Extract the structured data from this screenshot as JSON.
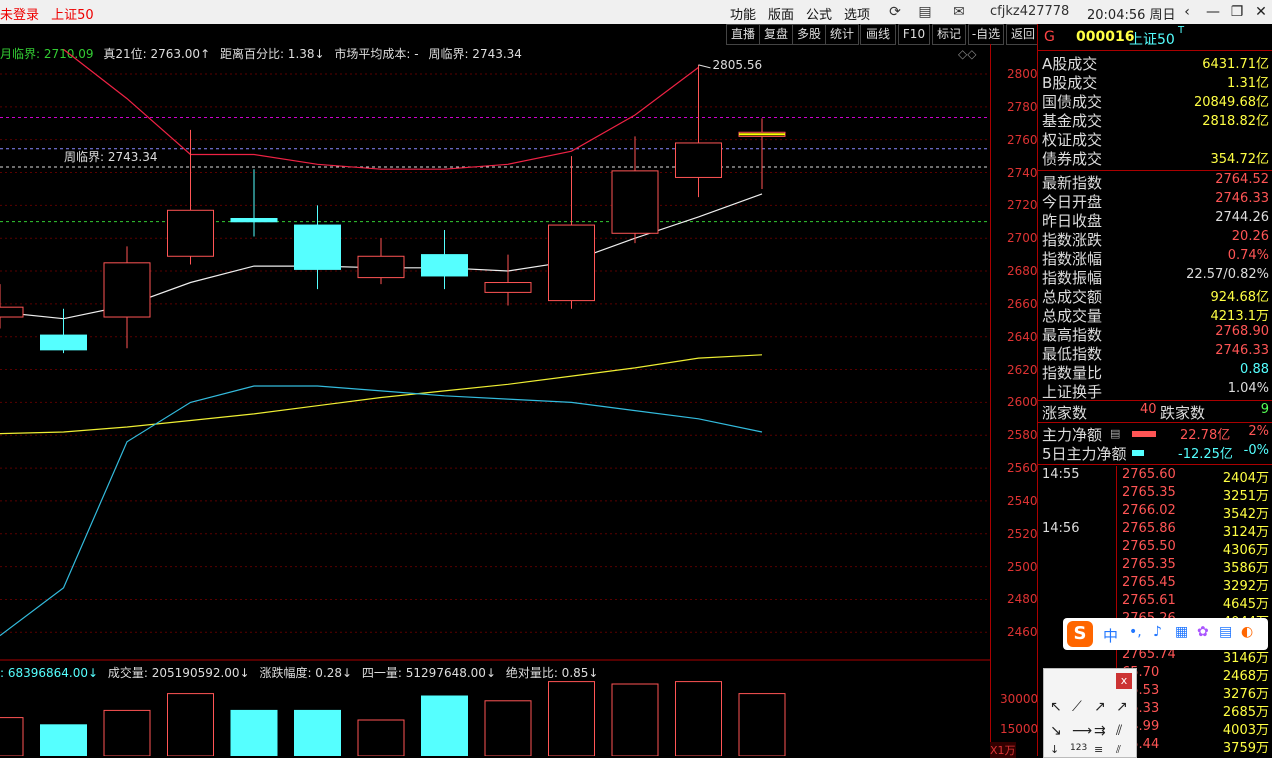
{
  "topbar": {
    "status": "未登录",
    "index_name": "上证50",
    "menus": [
      "功能",
      "版面",
      "公式",
      "选项"
    ],
    "user": "cfjkz427778",
    "time": "20:04:56 周日"
  },
  "toolbar": {
    "buttons": [
      "直播",
      "复盘",
      "多股",
      "统计",
      "画线",
      "F10",
      "标记",
      "-自选",
      "返回"
    ]
  },
  "infoline": {
    "items": [
      "月临界: 2710.09",
      "真21位: 2763.00↑",
      "距离百分比: 1.38↓",
      "市场平均成本: -",
      "周临界: 2743.34"
    ]
  },
  "chart_labels": {
    "high_label": "2805.56",
    "week_label": "周临界: 2743.34"
  },
  "volume_line": {
    "items": [
      ": 68396864.00↓",
      "成交量: 205190592.00↓",
      "涨跌幅度: 0.28↓",
      "四一量: 51297648.00↓",
      "绝对量比: 0.85↓"
    ],
    "axis_ticks": [
      "30000",
      "15000"
    ],
    "unit": "X1万"
  },
  "chart_data": {
    "type": "candlestick",
    "y_ticks": [
      2800,
      2780,
      2760,
      2740,
      2720,
      2700,
      2680,
      2660,
      2640,
      2620,
      2600,
      2580,
      2560,
      2540,
      2520,
      2500,
      2480,
      2460
    ],
    "ylim": [
      2448,
      2818
    ],
    "ohlc": [
      {
        "o": 2652,
        "c": 2658,
        "h": 2672,
        "l": 2645
      },
      {
        "o": 2641,
        "c": 2632,
        "h": 2657,
        "l": 2630
      },
      {
        "o": 2652,
        "c": 2685,
        "h": 2695,
        "l": 2633
      },
      {
        "o": 2689,
        "c": 2717,
        "h": 2766,
        "l": 2684
      },
      {
        "o": 2712,
        "c": 2710,
        "h": 2742,
        "l": 2701
      },
      {
        "o": 2708,
        "c": 2681,
        "h": 2720,
        "l": 2669
      },
      {
        "o": 2676,
        "c": 2689,
        "h": 2700,
        "l": 2672
      },
      {
        "o": 2690,
        "c": 2677,
        "h": 2705,
        "l": 2669
      },
      {
        "o": 2667,
        "c": 2673,
        "h": 2690,
        "l": 2659
      },
      {
        "o": 2662,
        "c": 2708,
        "h": 2750,
        "l": 2657
      },
      {
        "o": 2703,
        "c": 2741,
        "h": 2762,
        "l": 2697
      },
      {
        "o": 2737,
        "c": 2758,
        "h": 2805.56,
        "l": 2725
      },
      {
        "o": 2762,
        "c": 2764.52,
        "h": 2773,
        "l": 2730
      }
    ],
    "ma_white": [
      2655,
      2651,
      2659,
      2673,
      2683,
      2683,
      2682,
      2682,
      2680,
      2686,
      2700,
      2713,
      2727
    ],
    "ma_red": [
      null,
      2815,
      2785,
      2751,
      2751,
      2745,
      2742,
      2742,
      2745,
      2753,
      2775,
      2804,
      null
    ],
    "ma_yellow": [
      2581,
      2582,
      2585,
      2589,
      2593,
      2598,
      2603,
      2607,
      2611,
      2616,
      2621,
      2627,
      2629
    ],
    "ma_blue": [
      2458,
      2487,
      2576,
      2600,
      2610,
      2610,
      2607,
      2604,
      2602,
      2600,
      2595,
      2590,
      2582
    ],
    "ref_lines": [
      {
        "value": 2773.5,
        "color": "#c0c"
      },
      {
        "value": 2754.5,
        "color": "#88f"
      },
      {
        "value": 2743.34,
        "color": "#ddd"
      },
      {
        "value": 2710.09,
        "color": "#3c3"
      }
    ],
    "volume": [
      16,
      13,
      19,
      26,
      19,
      19,
      15,
      25,
      23,
      31,
      30,
      31,
      26
    ],
    "volume_unit": "X1万"
  },
  "quote": {
    "flag": "G",
    "code": "000016",
    "name": "上证50",
    "mark": "T",
    "market": [
      {
        "k": "A股成交",
        "v": "6431.71亿",
        "c": "#ff4"
      },
      {
        "k": "B股成交",
        "v": "1.31亿",
        "c": "#ff4"
      },
      {
        "k": "国债成交",
        "v": "20849.68亿",
        "c": "#ff4"
      },
      {
        "k": "基金成交",
        "v": "2818.82亿",
        "c": "#ff4"
      },
      {
        "k": "权证成交",
        "v": "",
        "c": "#ff4"
      },
      {
        "k": "债券成交",
        "v": "354.72亿",
        "c": "#ff4"
      }
    ],
    "stats": [
      {
        "k": "最新指数",
        "v": "2764.52",
        "c": "#f55"
      },
      {
        "k": "今日开盘",
        "v": "2746.33",
        "c": "#f55"
      },
      {
        "k": "昨日收盘",
        "v": "2744.26",
        "c": "#ddd"
      },
      {
        "k": "指数涨跌",
        "v": "20.26",
        "c": "#f55"
      },
      {
        "k": "指数涨幅",
        "v": "0.74%",
        "c": "#f55"
      },
      {
        "k": "指数振幅",
        "v": "22.57/0.82%",
        "c": "#ddd"
      },
      {
        "k": "总成交额",
        "v": "924.68亿",
        "c": "#ff4"
      },
      {
        "k": "总成交量",
        "v": "4213.1万",
        "c": "#ff4"
      },
      {
        "k": "最高指数",
        "v": "2768.90",
        "c": "#f55"
      },
      {
        "k": "最低指数",
        "v": "2746.33",
        "c": "#f55"
      },
      {
        "k": "指数量比",
        "v": "0.88",
        "c": "#5ff"
      },
      {
        "k": "上证换手",
        "v": "1.04%",
        "c": "#ddd"
      }
    ],
    "up_label": "涨家数",
    "up_count": "40",
    "down_label": "跌家数",
    "down_count": "9",
    "flow1_label": "主力净额",
    "flow1_value": "22.78亿",
    "flow1_pct": "2%",
    "flow2_label": "5日主力净额",
    "flow2_value": "-12.25亿",
    "flow2_pct": "-0%"
  },
  "ticks": [
    {
      "t": "14:55",
      "p": "2765.60",
      "v": "2404万"
    },
    {
      "t": "",
      "p": "2765.35",
      "v": "3251万"
    },
    {
      "t": "",
      "p": "2766.02",
      "v": "3542万"
    },
    {
      "t": "14:56",
      "p": "2765.86",
      "v": "3124万"
    },
    {
      "t": "",
      "p": "2765.50",
      "v": "4306万"
    },
    {
      "t": "",
      "p": "2765.35",
      "v": "3586万"
    },
    {
      "t": "",
      "p": "2765.45",
      "v": "3292万"
    },
    {
      "t": "",
      "p": "2765.61",
      "v": "4645万"
    },
    {
      "t": "",
      "p": "2765.26",
      "v": "4044万"
    },
    {
      "t": "",
      "p": "",
      "v": ""
    },
    {
      "t": "",
      "p": "2765.74",
      "v": "3146万"
    },
    {
      "t": "",
      "p": "65.70",
      "v": "2468万"
    },
    {
      "t": "",
      "p": "65.53",
      "v": "3276万"
    },
    {
      "t": "",
      "p": "65.33",
      "v": "2685万"
    },
    {
      "t": "",
      "p": "64.99",
      "v": "4003万"
    },
    {
      "t": "",
      "p": "65.44",
      "v": "3759万"
    }
  ],
  "ime": {
    "logo": "S",
    "lang": "中"
  }
}
